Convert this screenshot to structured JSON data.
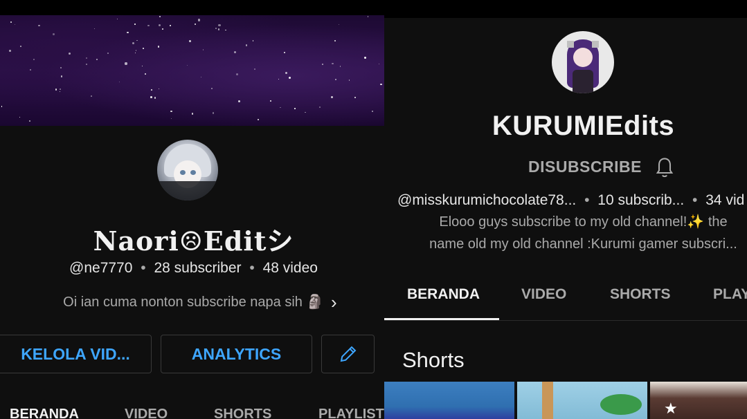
{
  "left_panel": {
    "channel_name": "Naori☹Editシ",
    "handle": "@ne7770",
    "subscribers": "28 subscriber",
    "videos": "48 video",
    "separator": "•",
    "description": "Oi ian cuma nonton subscribe napa sih",
    "description_emoji": "🗿",
    "more_chevron": "›",
    "buttons": {
      "manage": "KELOLA VID...",
      "analytics": "ANALYTICS"
    },
    "tabs": [
      "BERANDA",
      "VIDEO",
      "SHORTS",
      "PLAYLIST"
    ]
  },
  "right_panel": {
    "channel_name": "KURUMIEdits",
    "subscribe_label": "DISUBSCRIBE",
    "handle": "@misskurumichocolate78...",
    "subscribers": "10 subscrib...",
    "videos": "34 vid",
    "separator": "•",
    "description_line1": "Elooo guys subscribe to my old channel!✨ the",
    "description_line2": "name old my old channel :Kurumi gamer subscri...",
    "tabs": [
      "BERANDA",
      "VIDEO",
      "SHORTS",
      "PLAY"
    ],
    "section_heading": "Shorts"
  },
  "colors": {
    "background": "#0f0f0f",
    "accent_blue": "#3ea6ff",
    "text_primary": "#f1f1f1",
    "text_secondary": "#aaaaaa"
  },
  "icons": {
    "edit": "pencil-icon",
    "bell": "bell-icon",
    "chevron": "chevron-right-icon"
  }
}
